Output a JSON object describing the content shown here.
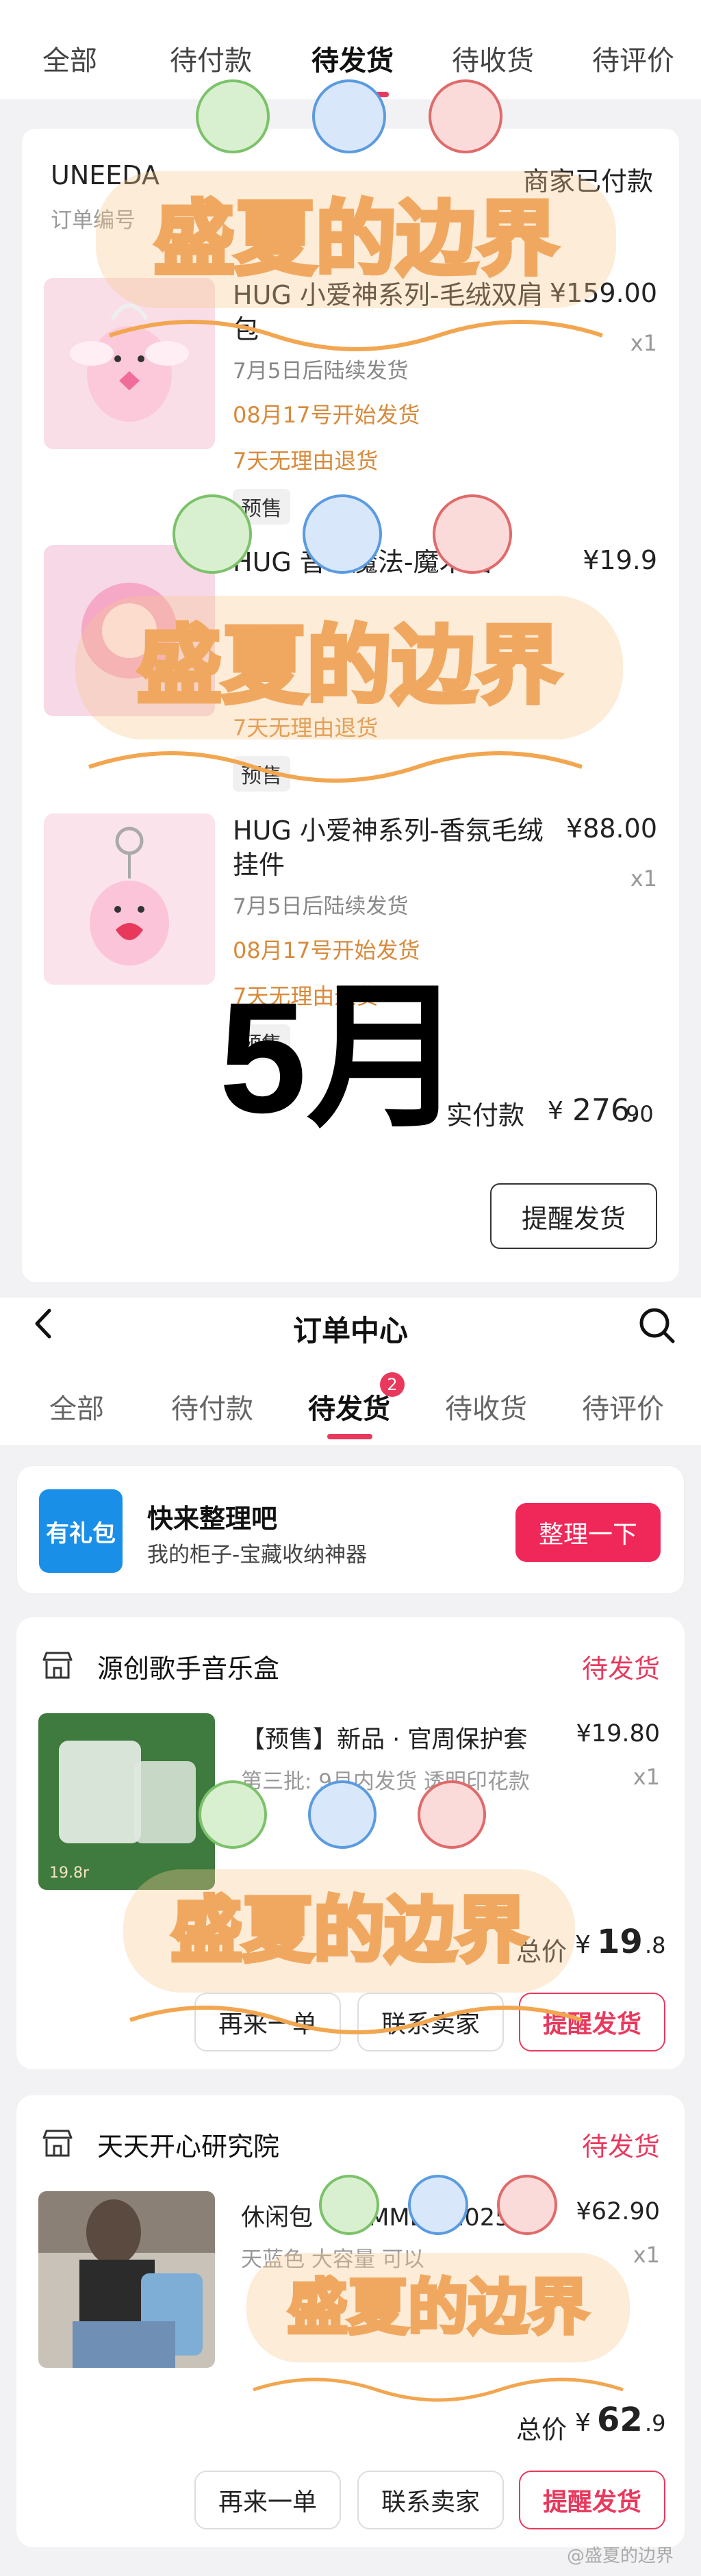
{
  "tabs_top": [
    "全部",
    "待付款",
    "待发货",
    "待收货",
    "待评价"
  ],
  "order1": {
    "store": "UNEEDA",
    "status": "商家已付款",
    "order_no": "订单编号",
    "items": [
      {
        "title": "HUG 小爱神系列-毛绒双肩包",
        "price": "¥159.00",
        "qty": "x1",
        "ship": "7月5日后陆续发货",
        "date": "08月17号开始发货",
        "return": "7天无理由退货",
        "tag": "预售"
      },
      {
        "title": "HUG 音乐魔法-魔术贴",
        "price": "¥19.9",
        "qty": "",
        "ship": "",
        "date": "",
        "return": "7天无理由退货",
        "tag": "预售"
      },
      {
        "title": "HUG 小爱神系列-香氛毛绒挂件",
        "price": "¥88.00",
        "qty": "x1",
        "ship": "7月5日后陆续发货",
        "date": "08月17号开始发货",
        "return": "7天无理由退货",
        "tag": "预售"
      }
    ],
    "paid_label": "实付款",
    "paid_symbol": "¥",
    "paid_int": "276.",
    "paid_dec": "90",
    "remind_button": "提醒发货"
  },
  "month_overlay": "5月",
  "nav": {
    "title": "订单中心",
    "tabs": [
      "全部",
      "待付款",
      "待发货",
      "待收货",
      "待评价"
    ],
    "badge": "2"
  },
  "promo": {
    "icon_text": "有礼包",
    "title": "快来整理吧",
    "subtitle": "我的柜子-宝藏收纳神器",
    "button": "整理一下"
  },
  "orders": [
    {
      "shop": "源创歌手音乐盒",
      "status": "待发货",
      "title": "【预售】新品 · 官周保护套",
      "price": "¥19.80",
      "spec": "第三批: 9月内发货 透明印花款",
      "qty": "x1",
      "total_label": "总价",
      "total_symbol": "¥",
      "total_int": "19",
      "total_dec": ".8",
      "buttons": [
        "再来一单",
        "联系卖家",
        "提醒发货"
      ],
      "thumb_label": "19.8r"
    },
    {
      "shop": "天天开心研究院",
      "status": "待发货",
      "title": "休闲包 · SUMMER 2025",
      "price": "¥62.90",
      "spec": "天蓝色 大容量 可以",
      "qty": "x1",
      "total_label": "总价",
      "total_symbol": "¥",
      "total_int": "62",
      "total_dec": ".9",
      "buttons": [
        "再来一单",
        "联系卖家",
        "提醒发货"
      ],
      "thumb_label": ""
    }
  ],
  "watermark": "盛夏的边界",
  "credit": "@盛夏的边界",
  "colors": {
    "accent": "#e8395d",
    "orange": "#d88a3a",
    "watermark": "#f0a860"
  }
}
